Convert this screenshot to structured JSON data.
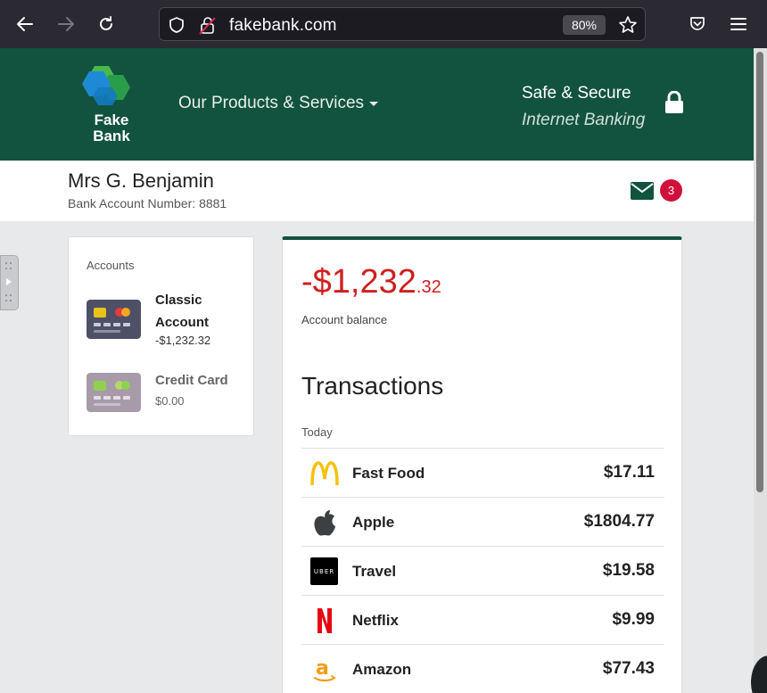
{
  "browser": {
    "url": "fakebank.com",
    "zoom": "80%"
  },
  "header": {
    "logo_line1": "Fake",
    "logo_line2": "Bank",
    "menu_label": "Our Products & Services",
    "secure_line1": "Safe & Secure",
    "secure_line2": "Internet Banking"
  },
  "user": {
    "name": "Mrs G. Benjamin",
    "account_number": "Bank Account Number: 8881",
    "message_count": "3"
  },
  "accounts": {
    "title": "Accounts",
    "items": [
      {
        "name_line1": "Classic",
        "name_line2": "Account",
        "balance": "-$1,232.32"
      },
      {
        "name_line1": "Credit Card",
        "balance": "$0.00"
      }
    ]
  },
  "summary": {
    "balance_main": "-$1,232",
    "balance_cents": ".32",
    "balance_label": "Account balance",
    "transactions_heading": "Transactions",
    "day_label": "Today"
  },
  "transactions": [
    {
      "name": "Fast Food",
      "amount": "$17.11",
      "icon": "mcdonalds-icon"
    },
    {
      "name": "Apple",
      "amount": "$1804.77",
      "icon": "apple-icon"
    },
    {
      "name": "Travel",
      "amount": "$19.58",
      "icon": "uber-icon",
      "icon_text": "UBER"
    },
    {
      "name": "Netflix",
      "amount": "$9.99",
      "icon": "netflix-icon"
    },
    {
      "name": "Amazon",
      "amount": "$77.43",
      "icon": "amazon-icon"
    }
  ],
  "colors": {
    "brand_green": "#12533f",
    "negative_red": "#d01f1f",
    "badge_red": "#d0103a"
  }
}
